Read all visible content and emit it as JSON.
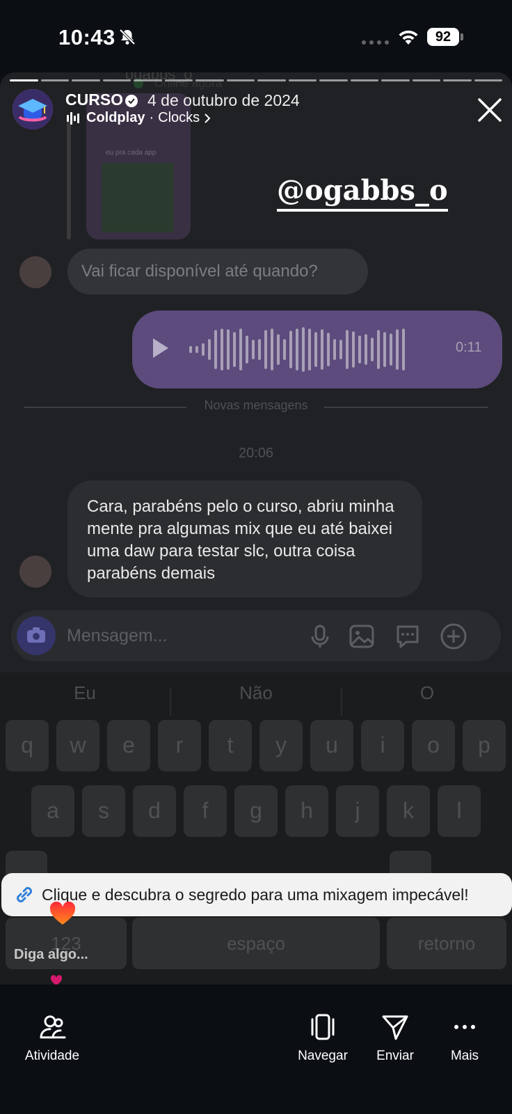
{
  "status_bar": {
    "time": "10:43",
    "battery": "92",
    "icons": [
      "bell-slash-icon",
      "cellular-signal-icon",
      "wifi-icon",
      "battery-icon"
    ]
  },
  "story": {
    "account_name": "CURSO",
    "date": "4 de outubro de 2024",
    "music_artist": "Coldplay",
    "music_separator": "·",
    "music_title": "Clocks",
    "mention": "@ogabbs_o",
    "link_text": "Clique e descubra o segredo para uma mixagem impecável!",
    "reply_placeholder": "Diga algo...",
    "segments": 16
  },
  "chat_screenshot": {
    "contact_name": "ogabbs_o",
    "contact_status": "Online agora",
    "card_caption": "eu pra cada app",
    "incoming_question": "Vai ficar disponível até quando?",
    "voice_duration": "0:11",
    "new_messages_label": "Novas mensagens",
    "time_label": "20:06",
    "message": "Cara, parabéns pelo o curso, abriu minha mente pra algumas mix que eu até baixei uma daw para testar slc, outra coisa parabéns demais",
    "composer_placeholder": "Mensagem...",
    "keyboard": {
      "suggestions": [
        "Eu",
        "Não",
        "O"
      ],
      "row1": [
        "q",
        "w",
        "e",
        "r",
        "t",
        "y",
        "u",
        "i",
        "o",
        "p"
      ],
      "row2": [
        "a",
        "s",
        "d",
        "f",
        "g",
        "h",
        "j",
        "k",
        "l"
      ],
      "numbers_key": "123",
      "space_key": "espaço",
      "return_key": "retorno"
    }
  },
  "bottom_nav": {
    "activity": "Atividade",
    "browse": "Navegar",
    "send": "Enviar",
    "more": "Mais"
  },
  "colors": {
    "voice_bubble": "#5c4b7c",
    "link_icon": "#2f7fd8",
    "heart": "#ff4d2e"
  }
}
